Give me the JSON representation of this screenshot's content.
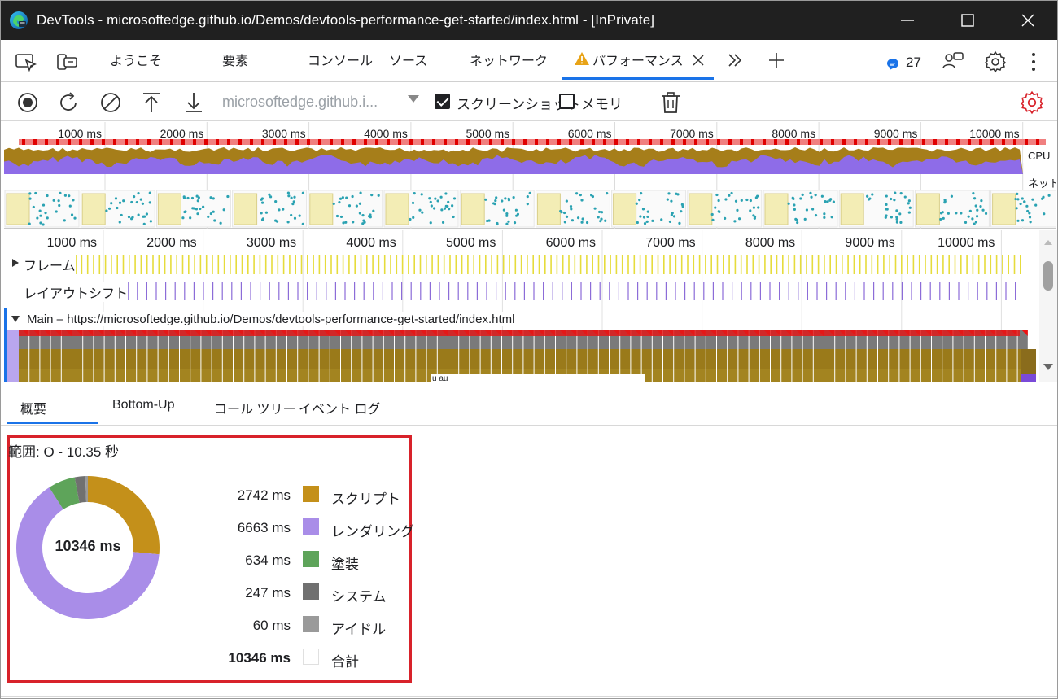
{
  "window": {
    "title": "DevTools - microsoftedge.github.io/Demos/devtools-performance-get-started/index.html - [InPrivate]"
  },
  "tabs": [
    {
      "label": "ようこそ"
    },
    {
      "label": "要素"
    },
    {
      "label": "コンソール"
    },
    {
      "label": "ソース"
    },
    {
      "label": "ネットワーク"
    },
    {
      "label": "パフォーマンス"
    }
  ],
  "issues_count": "27",
  "perf_toolbar": {
    "profile_select": "microsoftedge.github.i...",
    "screenshot_label": "スクリーンショット",
    "screenshot_checked": true,
    "memory_label": "メモリ",
    "memory_checked": false
  },
  "overview": {
    "ticks": [
      "1000 ms",
      "2000 ms",
      "3000 ms",
      "4000 ms",
      "5000 ms",
      "6000 ms",
      "7000 ms",
      "8000 ms",
      "9000 ms",
      "10000 ms"
    ],
    "cpu_label": "CPU",
    "net_label": "ネット"
  },
  "timeline": {
    "ticks": [
      "1000 ms",
      "2000 ms",
      "3000 ms",
      "4000 ms",
      "5000 ms",
      "6000 ms",
      "7000 ms",
      "8000 ms",
      "9000 ms",
      "10000 ms"
    ],
    "frames_label": "フレーム",
    "layout_shifts_label": "レイアウトシフト",
    "main_label": "Main – https://microsoftedge.github.io/Demos/devtools-performance-get-started/index.html",
    "inline_text": "u au"
  },
  "bottom_tabs": [
    {
      "label": "概要"
    },
    {
      "label": "Bottom-Up"
    },
    {
      "label": "コール ツリー"
    },
    {
      "label": "イベント ログ"
    }
  ],
  "summary": {
    "range_label": "範囲: O - 10.35 秒",
    "total_center": "10346 ms",
    "items": [
      {
        "value": "2742 ms",
        "name": "スクリプト",
        "color": "#c4901a",
        "ms": 2742
      },
      {
        "value": "6663 ms",
        "name": "レンダリング",
        "color": "#a98de8",
        "ms": 6663
      },
      {
        "value": "634 ms",
        "name": "塗装",
        "color": "#5ea45a",
        "ms": 634
      },
      {
        "value": "247 ms",
        "name": "システム",
        "color": "#707070",
        "ms": 247
      },
      {
        "value": "60 ms",
        "name": "アイドル",
        "color": "#9a9a9a",
        "ms": 60
      }
    ],
    "total": {
      "value": "10346 ms",
      "name": "合計"
    }
  },
  "colors": {
    "accent": "#1a73e8",
    "highlight_box": "#d8222a",
    "script": "#c4901a",
    "rendering": "#a98de8"
  }
}
